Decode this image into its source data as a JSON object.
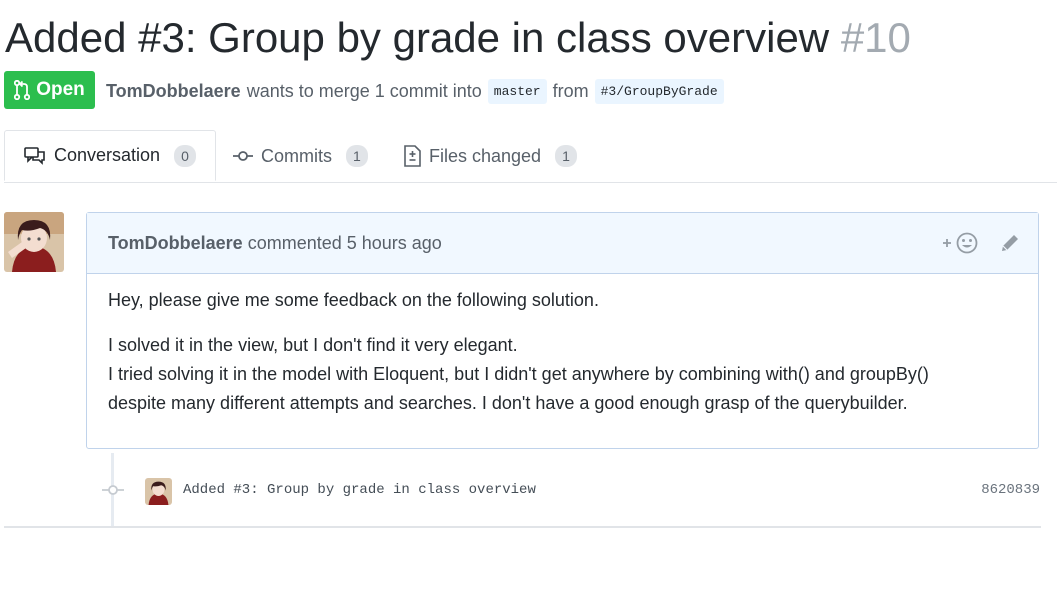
{
  "header": {
    "title": "Added #3: Group by grade in class overview",
    "number": "#10"
  },
  "state": {
    "label": "Open"
  },
  "meta": {
    "author": "TomDobbelaere",
    "text": "wants to merge 1 commit into",
    "base_branch": "master",
    "from_text": "from",
    "head_branch": "#3/GroupByGrade"
  },
  "tabs": [
    {
      "label": "Conversation",
      "count": "0",
      "icon": "comment-discussion-icon"
    },
    {
      "label": "Commits",
      "count": "1",
      "icon": "git-commit-icon"
    },
    {
      "label": "Files changed",
      "count": "1",
      "icon": "file-diff-icon"
    }
  ],
  "comment": {
    "author": "TomDobbelaere",
    "action": "commented",
    "time": "5 hours ago",
    "body": {
      "p1": "Hey, please give me some feedback on the following solution.",
      "p2_line1": "I solved it in the view, but I don't find it very elegant.",
      "p2_line2": "I tried solving it in the model with Eloquent, but I didn't get anywhere by combining with() and groupBy()",
      "p2_line3": "despite many different attempts and searches. I don't have a good enough grasp of the querybuilder."
    },
    "reaction_icon": "smiley-add-icon",
    "edit_icon": "pencil-icon"
  },
  "commit": {
    "message": "Added #3: Group by grade in class overview",
    "sha": "8620839"
  },
  "colors": {
    "open_green": "#2cbe4e",
    "branch_bg": "#eaf5ff",
    "comment_header_bg": "#f1f8ff",
    "comment_border": "#c0d3eb"
  }
}
